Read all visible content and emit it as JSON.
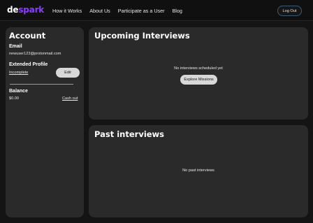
{
  "nav": {
    "logo_part1": "de",
    "logo_part2": "spark",
    "links": [
      "How it Works",
      "About Us",
      "Participate as a User",
      "Blog"
    ],
    "logout_label": "Log Out"
  },
  "account": {
    "title": "Account",
    "email_label": "Email",
    "email_value": "newuser123@protonmail.com",
    "extended_profile_label": "Extended Profile",
    "extended_profile_status": "Incomplete",
    "edit_label": "Edit",
    "balance_label": "Balance",
    "balance_value": "$0.00",
    "cash_out_label": "Cash out"
  },
  "upcoming": {
    "title": "Upcoming Interviews",
    "empty_text": "No interviews scheduled yet",
    "explore_label": "Explore Missions"
  },
  "past": {
    "title": "Past interviews",
    "empty_text": "No past interviews"
  },
  "colors": {
    "background": "#141414",
    "card": "#2a2a2a",
    "accent": "#8b3dff"
  }
}
